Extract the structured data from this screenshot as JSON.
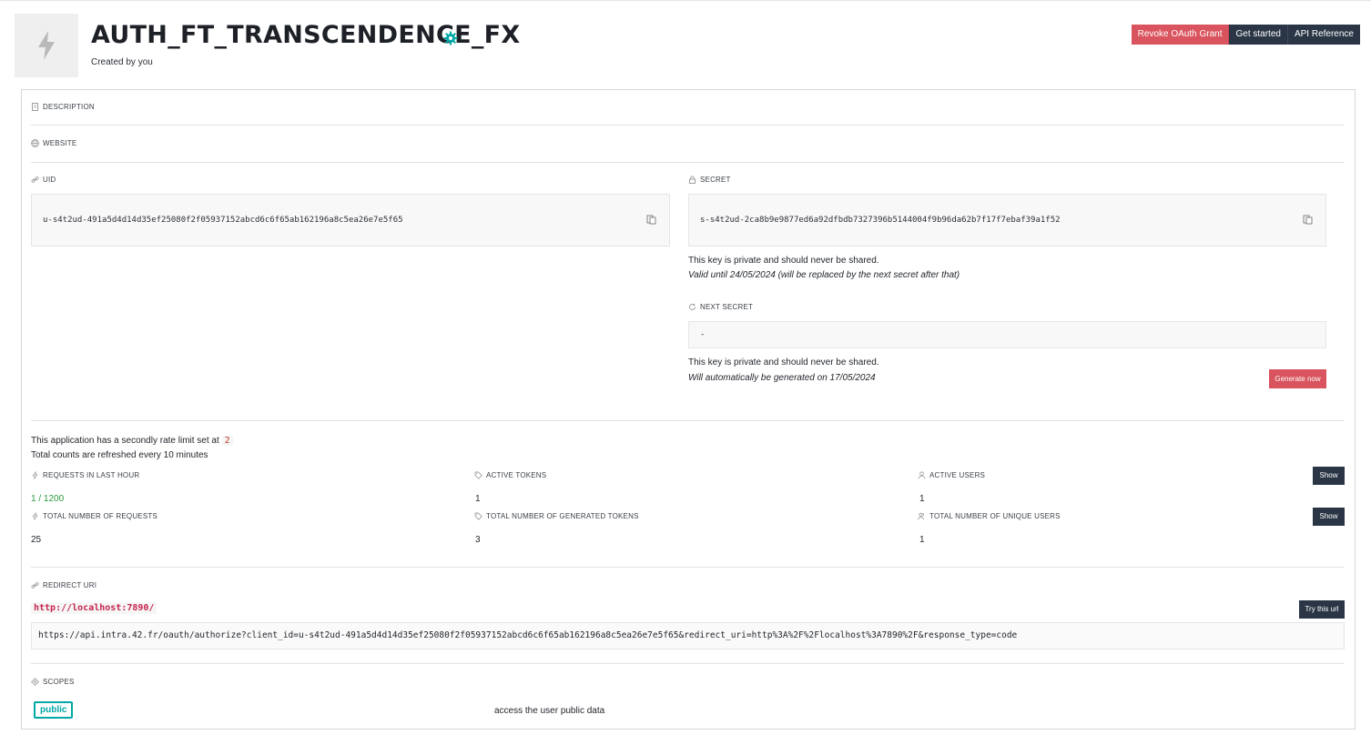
{
  "app": {
    "title": "AUTH_FT_TRANSCENDENCE_FX",
    "created_by": "Created by you",
    "logo_icon": "lightning-icon",
    "settings_icon": "gear-icon",
    "accent_color": "#00a8a6"
  },
  "header_buttons": {
    "revoke": "Revoke OAuth Grant",
    "get_started": "Get started",
    "api_reference": "API Reference"
  },
  "sections": {
    "description_label": "DESCRIPTION",
    "website_label": "WEBSITE"
  },
  "uid": {
    "label": "UID",
    "value": "u-s4t2ud-491a5d4d14d35ef25080f2f05937152abcd6c6f65ab162196a8c5ea26e7e5f65"
  },
  "secret": {
    "label": "SECRET",
    "value": "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",
    "note": "This key is private and should never be shared.",
    "validity": "Valid until 24/05/2024 (will be replaced by the next secret after that)"
  },
  "next_secret": {
    "label": "NEXT SECRET",
    "value": "-",
    "note": "This key is private and should never be shared.",
    "auto_gen": "Will automatically be generated on 17/05/2024",
    "generate_button": "Generate now"
  },
  "rate": {
    "text": "This application has a secondly rate limit set at",
    "limit": "2",
    "refresh": "Total counts are refreshed every 10 minutes"
  },
  "stats": {
    "requests_hour_label": "REQUESTS IN LAST HOUR",
    "requests_hour_value": "1 / 1200",
    "active_tokens_label": "ACTIVE TOKENS",
    "active_tokens_value": "1",
    "active_users_label": "ACTIVE USERS",
    "active_users_value": "1",
    "total_requests_label": "TOTAL NUMBER OF REQUESTS",
    "total_requests_value": "25",
    "total_tokens_label": "TOTAL NUMBER OF GENERATED TOKENS",
    "total_tokens_value": "3",
    "unique_users_label": "TOTAL NUMBER OF UNIQUE USERS",
    "unique_users_value": "1",
    "show_button": "Show"
  },
  "redirect": {
    "label": "REDIRECT URI",
    "uri": "http://localhost:7890/",
    "try_button": "Try this url",
    "authorize_url": "https://api.intra.42.fr/oauth/authorize?client_id=u-s4t2ud-491a5d4d14d35ef25080f2f05937152abcd6c6f65ab162196a8c5ea26e7e5f65&redirect_uri=http%3A%2F%2Flocalhost%3A7890%2F&response_type=code"
  },
  "scopes": {
    "label": "SCOPES",
    "items": [
      {
        "name": "public",
        "description": "access the user public data"
      }
    ]
  }
}
